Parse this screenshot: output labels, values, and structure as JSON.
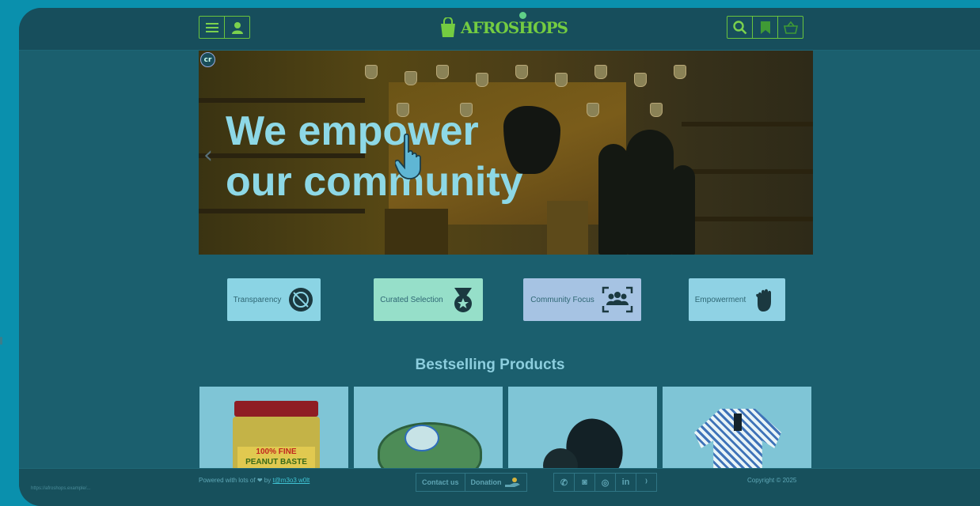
{
  "header": {
    "logo_text": "AFROSHOPS",
    "menu_icon": "menu-icon",
    "account_icon": "user-icon",
    "search_icon": "search-icon",
    "bookmark_icon": "bookmark-icon",
    "cart_icon": "basket-icon"
  },
  "hero": {
    "title_line1": "We empower",
    "title_line2": "our community",
    "badge": "cr"
  },
  "features": [
    {
      "label": "Transparency",
      "icon": "ring-icon",
      "color": "#8bd4e4"
    },
    {
      "label": "Curated Selection",
      "icon": "medal-icon",
      "color": "#96dfc9"
    },
    {
      "label": "Community Focus",
      "icon": "group-icon",
      "color": "#a6c3e3"
    },
    {
      "label": "Empowerment",
      "icon": "fist-icon",
      "color": "#8fd2e4"
    }
  ],
  "bestselling": {
    "title": "Bestselling Products",
    "products": [
      {
        "name": "Peanut butter jar",
        "label_line1": "100% FINE",
        "label_line2": "PEANUT BASTE"
      },
      {
        "name": "Packaged sausages",
        "label_line1": "",
        "label_line2": ""
      },
      {
        "name": "Dark produce",
        "label_line1": "",
        "label_line2": ""
      },
      {
        "name": "Patterned shirt",
        "label_line1": "",
        "label_line2": ""
      }
    ]
  },
  "footer": {
    "powered_text": "Powered with lots of",
    "by_text": "by",
    "author_link": "t@m3o3 w0lt",
    "contact": "Contact us",
    "donation": "Donation",
    "copyright": "Copyright © 2025",
    "social_icons": [
      "whatsapp-icon",
      "telegram-icon",
      "instagram-icon",
      "linkedin-icon",
      "rss-icon"
    ],
    "linkedin_label": "in"
  },
  "status_tip": "https://afroshops.example/..."
}
